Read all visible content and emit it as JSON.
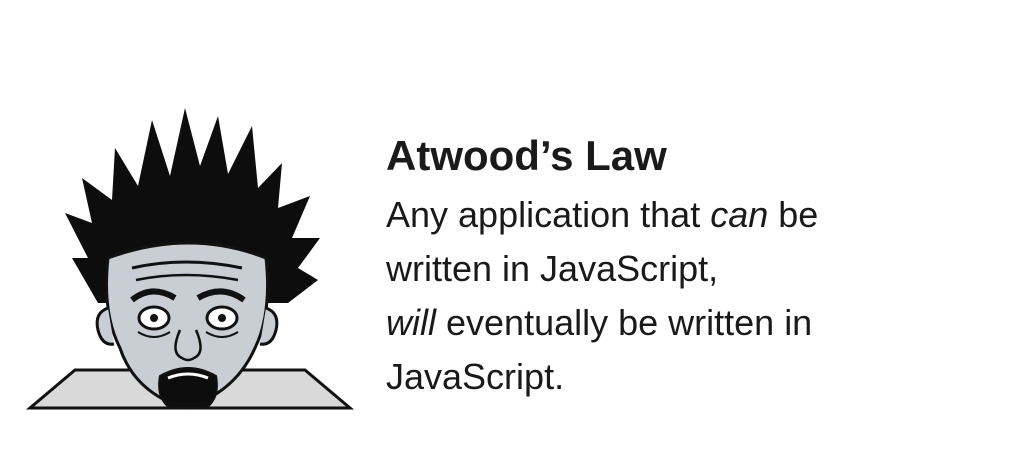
{
  "slide": {
    "title": "Atwood’s Law",
    "body": {
      "line1_before": "Any application that ",
      "line1_emph": "can",
      "line1_after": " be",
      "line2": "written in JavaScript,",
      "line3_emph": "will",
      "line3_after": " eventually be written in",
      "line4": "JavaScript."
    },
    "illustration": {
      "icon": "shocked-face-icon"
    }
  }
}
